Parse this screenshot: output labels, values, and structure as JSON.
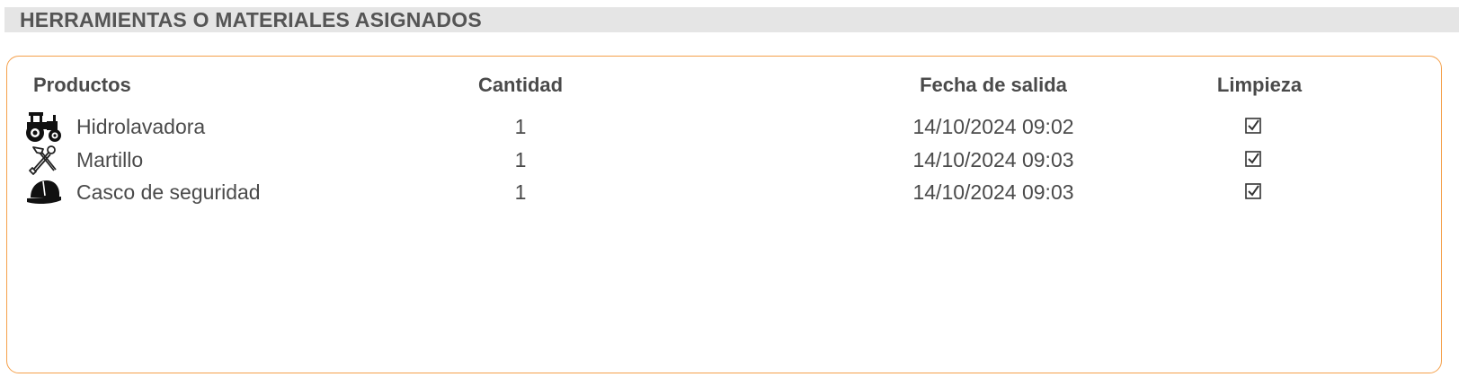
{
  "section": {
    "title": "HERRAMIENTAS O MATERIALES ASIGNADOS"
  },
  "table": {
    "headers": {
      "productos": "Productos",
      "cantidad": "Cantidad",
      "fecha": "Fecha de salida",
      "limpieza": "Limpieza"
    },
    "rows": [
      {
        "icon": "tractor-icon",
        "name": "Hidrolavadora",
        "quantity": "1",
        "date": "14/10/2024 09:02",
        "limpieza_checked": true
      },
      {
        "icon": "tools-icon",
        "name": "Martillo",
        "quantity": "1",
        "date": "14/10/2024 09:03",
        "limpieza_checked": true
      },
      {
        "icon": "hard-hat-icon",
        "name": "Casco de seguridad",
        "quantity": "1",
        "date": "14/10/2024 09:03",
        "limpieza_checked": true
      }
    ]
  },
  "colors": {
    "panel_border": "#f5a04a",
    "header_bg": "#e5e5e5",
    "text": "#4a4a4a"
  }
}
